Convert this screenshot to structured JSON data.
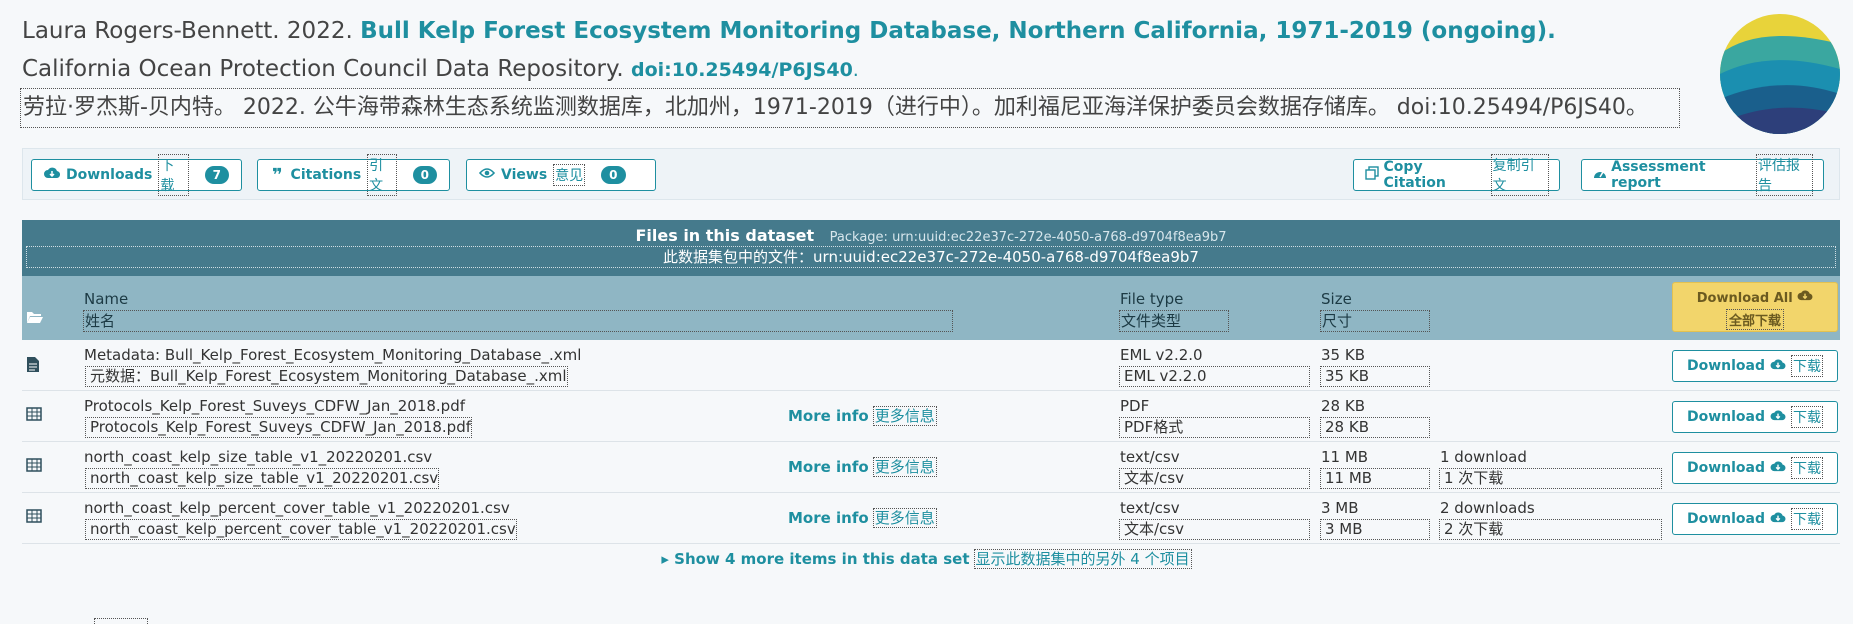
{
  "citation": {
    "authors": "Laura Rogers-Bennett. 2022.",
    "title": "Bull Kelp Forest Ecosystem Monitoring Database, Northern California, 1971-2019 (ongoing).",
    "repository": "California Ocean Protection Council Data Repository.",
    "doi": "doi:10.25494/P6JS40",
    "trailing_dot": ".",
    "translation": "劳拉·罗杰斯-贝内特。 2022. 公牛海带森林生态系统监测数据库，北加州，1971-2019（进行中）。加利福尼亚海洋保护委员会数据存储库。 doi:10.25494/P6JS40。"
  },
  "metrics": {
    "downloads": {
      "label": "Downloads",
      "zh": "下载",
      "count": "7",
      "icon": "cloud-download-icon"
    },
    "citations": {
      "label": "Citations",
      "zh": "引文",
      "count": "0",
      "icon": "quote-icon"
    },
    "views": {
      "label": "Views",
      "zh": "意见",
      "count": "0",
      "icon": "eye-icon"
    },
    "copy_citation": {
      "label": "Copy Citation",
      "zh": "复制引文",
      "icon": "copy-icon"
    },
    "assessment": {
      "label": "Assessment report",
      "zh": "评估报告",
      "icon": "dashboard-icon"
    }
  },
  "files_table": {
    "heading": "Files in this dataset",
    "package": "Package: urn:uuid:ec22e37c-272e-4050-a768-d9704f8ea9b7",
    "heading_zh": "此数据集包中的文件：urn:uuid:ec22e37c-272e-4050-a768-d9704f8ea9b7",
    "columns": {
      "name": "Name",
      "name_zh": "姓名",
      "type": "File type",
      "type_zh": "文件类型",
      "size": "Size",
      "size_zh": "尺寸"
    },
    "download_all": {
      "label": "Download All",
      "zh": "全部下载"
    },
    "more_info": {
      "label": "More info",
      "zh": "更多信息"
    },
    "download": {
      "label": "Download",
      "zh": "下载"
    },
    "rows": [
      {
        "name": "Metadata: Bull_Kelp_Forest_Ecosystem_Monitoring_Database_.xml",
        "name_zh": "元数据：Bull_Kelp_Forest_Ecosystem_Monitoring_Database_.xml",
        "type": "EML v2.2.0",
        "type_zh": "EML v2.2.0",
        "size": "35 KB",
        "size_zh": "35 KB",
        "downloads": "",
        "downloads_zh": "",
        "icon": "file-icon"
      },
      {
        "name": "Protocols_Kelp_Forest_Suveys_CDFW_Jan_2018.pdf",
        "name_zh": "Protocols_Kelp_Forest_Suveys_CDFW_Jan_2018.pdf",
        "type": "PDF",
        "type_zh": "PDF格式",
        "size": "28 KB",
        "size_zh": "28 KB",
        "downloads": "",
        "downloads_zh": "",
        "icon": "table-icon"
      },
      {
        "name": "north_coast_kelp_size_table_v1_20220201.csv",
        "name_zh": "north_coast_kelp_size_table_v1_20220201.csv",
        "type": "text/csv",
        "type_zh": "文本/csv",
        "size": "11 MB",
        "size_zh": "11 MB",
        "downloads": "1 download",
        "downloads_zh": "1 次下载",
        "icon": "table-icon"
      },
      {
        "name": "north_coast_kelp_percent_cover_table_v1_20220201.csv",
        "name_zh": "north_coast_kelp_percent_cover_table_v1_20220201.csv",
        "type": "text/csv",
        "type_zh": "文本/csv",
        "size": "3 MB",
        "size_zh": "3 MB",
        "downloads": "2 downloads",
        "downloads_zh": "2 次下载",
        "icon": "table-icon"
      }
    ],
    "show_more": {
      "label": "Show 4 more items in this data set",
      "zh": "显示此数据集中的另外 4 个项目"
    }
  },
  "colors": {
    "accent": "#1e8fa0",
    "header": "#457a8c",
    "subheader": "#8fb6c4",
    "download_all": "#f2d56b"
  }
}
